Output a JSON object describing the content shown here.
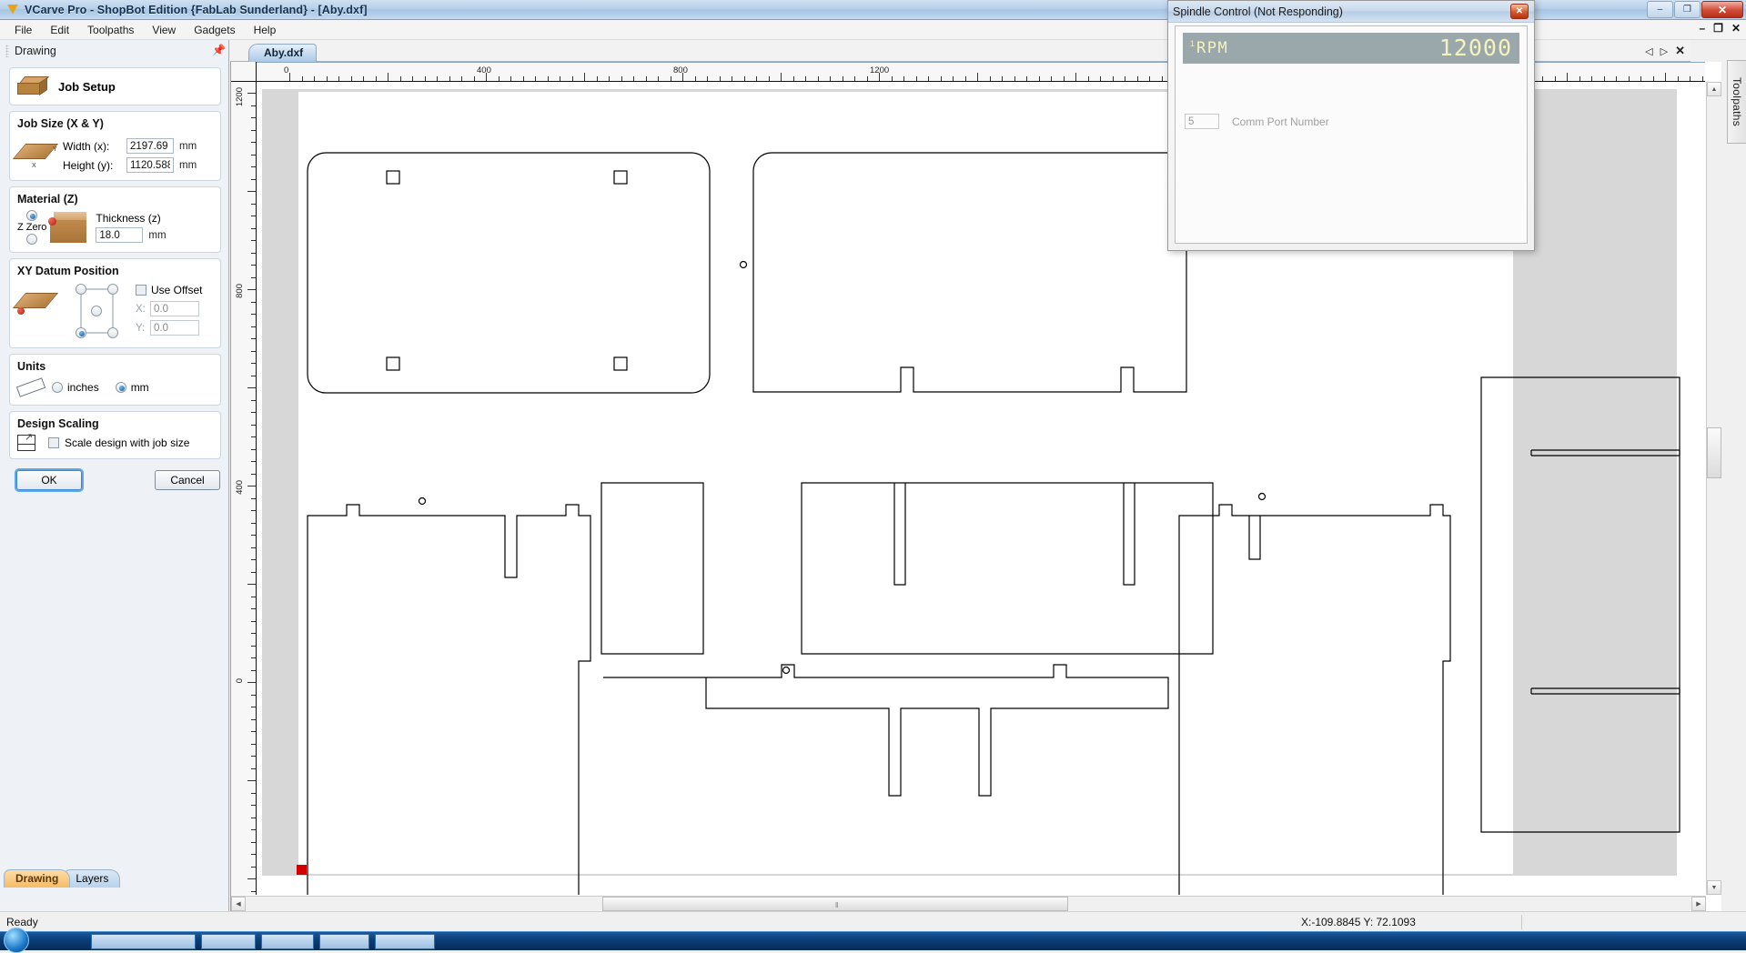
{
  "window": {
    "title": "VCarve Pro - ShopBot Edition {FabLab Sunderland} - [Aby.dxf]",
    "app_icon": "vcarve-logo-icon",
    "minimize": "–",
    "maximize": "❐",
    "close": "✕",
    "doc_minimize": "–",
    "doc_restore": "❐",
    "doc_close": "✕"
  },
  "menubar": {
    "items": [
      {
        "label": "File"
      },
      {
        "label": "Edit"
      },
      {
        "label": "Toolpaths"
      },
      {
        "label": "View"
      },
      {
        "label": "Gadgets"
      },
      {
        "label": "Help"
      }
    ]
  },
  "left_panel": {
    "header": "Drawing",
    "pin_icon": "pin-icon",
    "job_setup": {
      "title": "Job Setup",
      "icon": "job-box-icon"
    },
    "job_size": {
      "title": "Job Size (X & Y)",
      "icon": "plate-xy-icon",
      "width_label": "Width (x):",
      "width_value": "2197.69",
      "width_unit": "mm",
      "height_label": "Height (y):",
      "height_value": "1120.588",
      "height_unit": "mm"
    },
    "material": {
      "title": "Material (Z)",
      "icon": "material-block-icon",
      "z_zero_label": "Z Zero",
      "z_zero_top_selected": true,
      "z_zero_bottom_selected": false,
      "thickness_label": "Thickness (z)",
      "thickness_value": "18.0",
      "thickness_unit": "mm"
    },
    "xy_datum": {
      "title": "XY Datum Position",
      "icon": "datum-plate-icon",
      "selected_corner": "bottom-left",
      "use_offset_label": "Use Offset",
      "use_offset_checked": false,
      "x_label": "X:",
      "x_value": "0.0",
      "y_label": "Y:",
      "y_value": "0.0"
    },
    "units": {
      "title": "Units",
      "icon": "ruler-icon",
      "inches_label": "inches",
      "mm_label": "mm",
      "selected": "mm"
    },
    "design_scaling": {
      "title": "Design Scaling",
      "icon": "scale-arrow-icon",
      "checkbox_label": "Scale design with job size",
      "checked": false
    },
    "ok_label": "OK",
    "cancel_label": "Cancel",
    "tabs": [
      {
        "label": "Drawing",
        "active": true
      },
      {
        "label": "Layers",
        "active": false
      }
    ]
  },
  "document": {
    "tab_label": "Aby.dxf",
    "nav_prev_icon": "triangle-left-icon",
    "nav_next_icon": "triangle-right-icon",
    "nav_close_icon": "close-icon"
  },
  "right_dock": {
    "toolpaths_label": "Toolpaths"
  },
  "canvas": {
    "h_ruler_labels": [
      "0",
      "400",
      "800",
      "1200"
    ],
    "v_ruler_labels": [
      "1200",
      "800",
      "400",
      "0"
    ],
    "origin_marker": "red-origin-square",
    "scroll_up_icon": "▲",
    "scroll_down_icon": "▼",
    "scroll_left_icon": "◀",
    "scroll_right_icon": "▶",
    "scroll_grip_icon": "‖"
  },
  "spindle_dialog": {
    "title": "Spindle Control (Not Responding)",
    "close_icon": "✕",
    "rpm_superscript": "1",
    "rpm_label": "RPM",
    "rpm_value": "12000",
    "comm_port_value": "5",
    "comm_port_label": "Comm Port Number",
    "display_bg": "#9aa8ab",
    "display_fg": "#f4f2bd"
  },
  "status_bar": {
    "message": "Ready",
    "coordinates": "X:-109.8845 Y: 72.1093"
  }
}
